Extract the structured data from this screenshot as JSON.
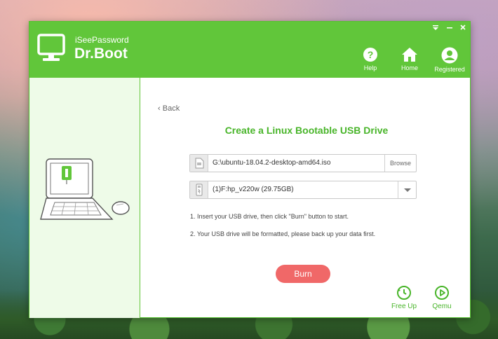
{
  "brand": {
    "subtitle": "iSeePassword",
    "title": "Dr.Boot"
  },
  "nav": [
    {
      "label": "Help"
    },
    {
      "label": "Home"
    },
    {
      "label": "Registered"
    }
  ],
  "back_label": "Back",
  "page_title": "Create a Linux Bootable USB Drive",
  "iso_field": {
    "value": "G:\\ubuntu-18.04.2-desktop-amd64.iso",
    "browse_label": "Browse"
  },
  "usb_select": {
    "value": "(1)F:hp_v220w (29.75GB)"
  },
  "instructions": [
    "1. Insert your USB drive, then click \"Burn\" button to start.",
    "2. Your USB drive will be formatted, please back up your data first."
  ],
  "burn_label": "Burn",
  "tools": [
    {
      "label": "Free Up"
    },
    {
      "label": "Qemu"
    }
  ],
  "colors": {
    "accent": "#61c63a",
    "title_green": "#49b52a",
    "burn": "#f06868",
    "sidebar_bg": "#eefbe8"
  },
  "icons": [
    "monitor-logo-icon",
    "help-icon",
    "home-icon",
    "user-icon",
    "menu-icon",
    "minimize-icon",
    "close-icon",
    "file-icon",
    "usb-icon",
    "chevron-down-icon",
    "free-up-icon",
    "qemu-icon"
  ]
}
